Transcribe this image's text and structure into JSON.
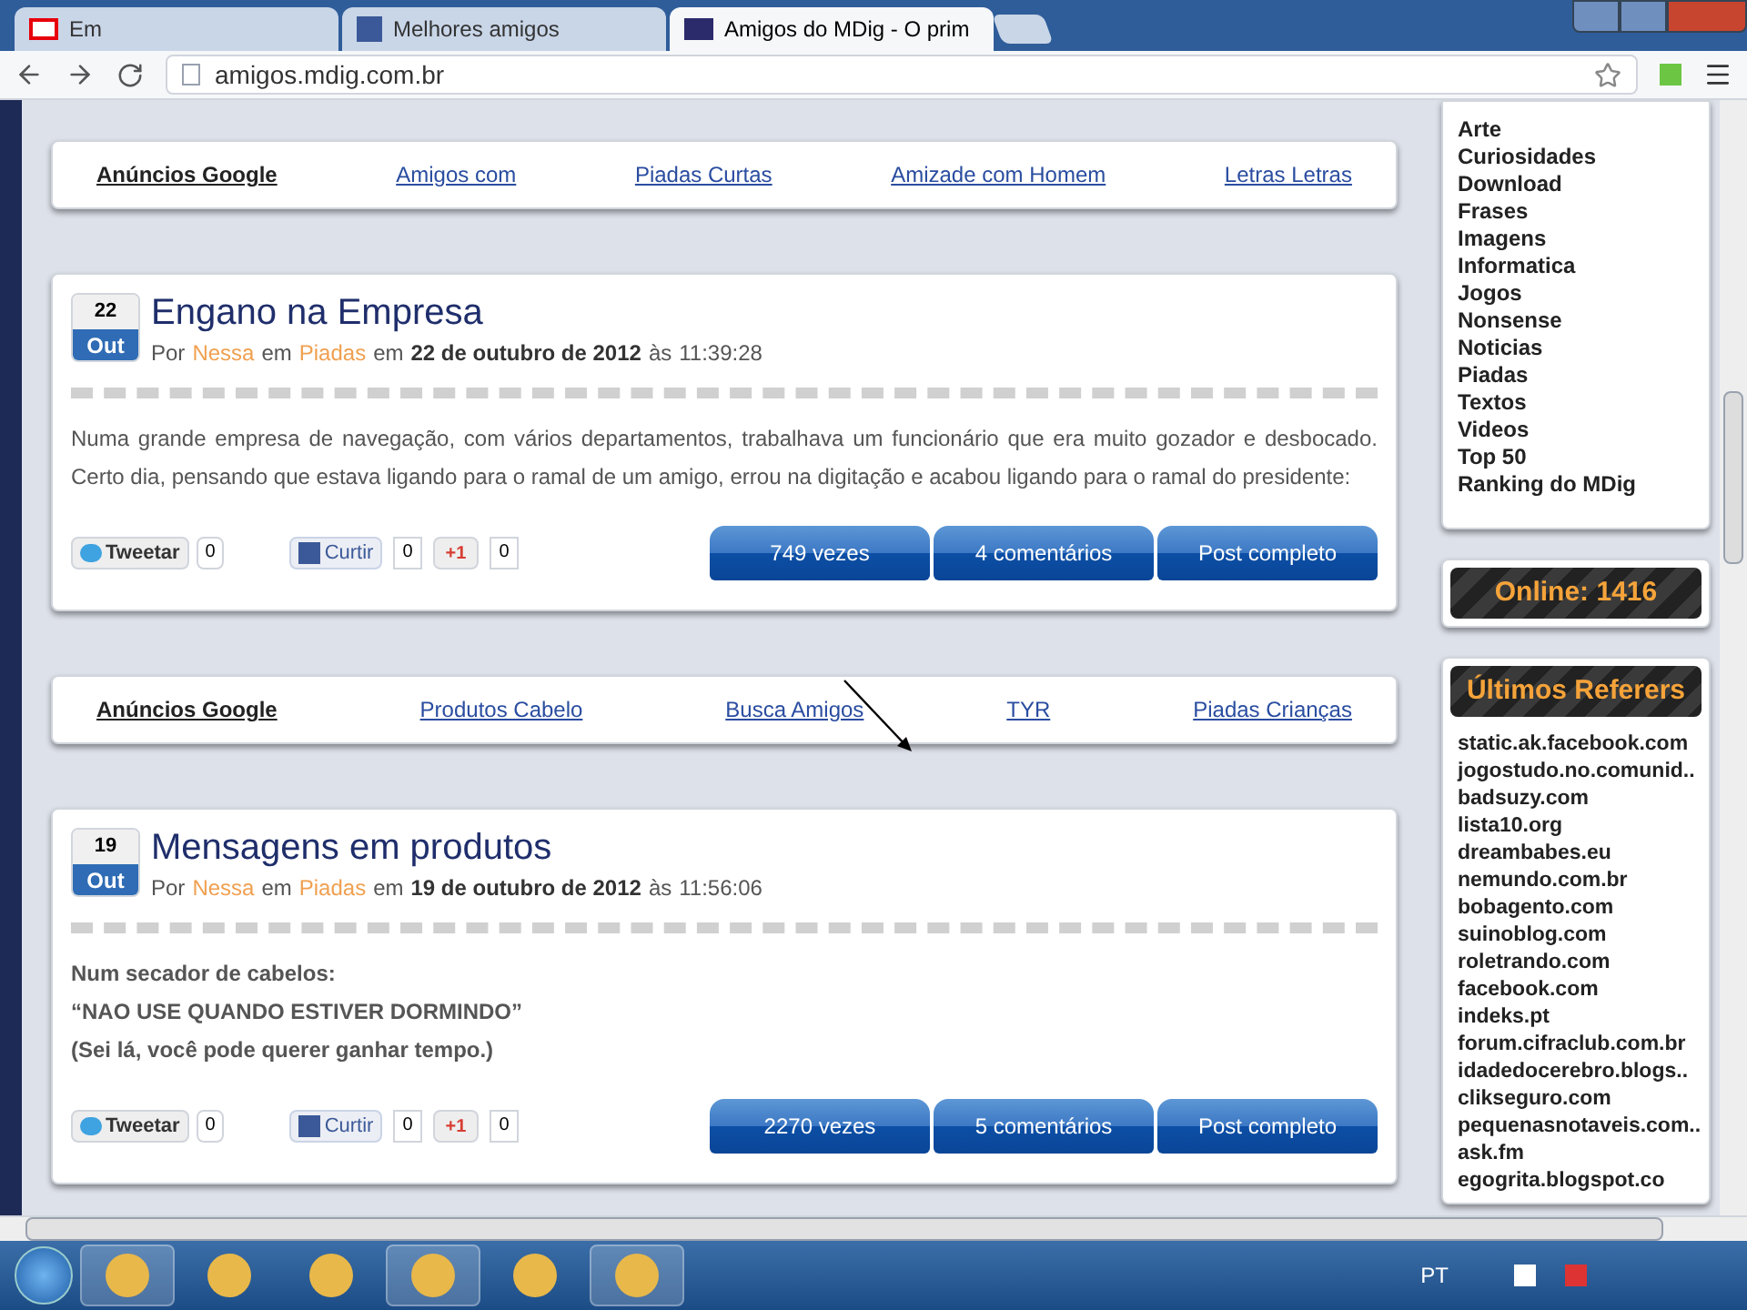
{
  "browser": {
    "tabs": [
      {
        "title": "Em",
        "selected": false
      },
      {
        "title": "Melhores amigos",
        "selected": false
      },
      {
        "title": "Amigos do MDig - O prim",
        "selected": true
      }
    ],
    "address": "amigos.mdig.com.br"
  },
  "ad_bars": [
    {
      "label": "Anúncios Google",
      "links": [
        "Amigos com",
        "Piadas Curtas",
        "Amizade com Homem",
        "Letras Letras"
      ]
    },
    {
      "label": "Anúncios Google",
      "links": [
        "Produtos Cabelo",
        "Busca Amigos",
        "TYR",
        "Piadas Crianças"
      ]
    }
  ],
  "posts": [
    {
      "day": "22",
      "month": "Out",
      "title": "Engano na Empresa",
      "by": "Por",
      "author": "Nessa",
      "in": "em",
      "category": "Piadas",
      "on": "em",
      "date": "22 de outubro de 2012",
      "at": "às",
      "time": "11:39:28",
      "bold_body": false,
      "body": [
        "Numa grande empresa de navegação, com vários departamentos, trabalhava um funcionário que era muito gozador e desbocado. Certo dia, pensando que estava ligando para o ramal de um amigo, errou na digitação e acabou ligando para o ramal do presidente:"
      ],
      "tweet": "Tweetar",
      "tweet_count": "0",
      "like": "Curtir",
      "like_count": "0",
      "plus": "+1",
      "plus_count": "0",
      "buttons": [
        "749 vezes",
        "4 comentários",
        "Post completo"
      ]
    },
    {
      "day": "19",
      "month": "Out",
      "title": "Mensagens em produtos",
      "by": "Por",
      "author": "Nessa",
      "in": "em",
      "category": "Piadas",
      "on": "em",
      "date": "19 de outubro de 2012",
      "at": "às",
      "time": "11:56:06",
      "bold_body": true,
      "body": [
        "Num secador de cabelos:",
        "“NAO USE QUANDO ESTIVER DORMINDO”",
        "(Sei lá, você pode querer ganhar tempo.)"
      ],
      "tweet": "Tweetar",
      "tweet_count": "0",
      "like": "Curtir",
      "like_count": "0",
      "plus": "+1",
      "plus_count": "0",
      "buttons": [
        "2270 vezes",
        "5 comentários",
        "Post completo"
      ]
    }
  ],
  "sidebar": {
    "categories": [
      "Arte",
      "Curiosidades",
      "Download",
      "Frases",
      "Imagens",
      "Informatica",
      "Jogos",
      "Nonsense",
      "Noticias",
      "Piadas",
      "Textos",
      "Videos",
      "Top 50",
      "Ranking do MDig"
    ],
    "online": "Online: 1416",
    "referers_title": "Últimos Referers",
    "referers": [
      "static.ak.facebook.com",
      "jogostudo.no.comunid..",
      "badsuzy.com",
      "lista10.org",
      "dreambabes.eu",
      "nemundo.com.br",
      "bobagento.com",
      "suinoblog.com",
      "roletrando.com",
      "facebook.com",
      "indeks.pt",
      "forum.cifraclub.com.br",
      "idadedocerebro.blogs..",
      "clikseguro.com",
      "pequenasnotaveis.com..",
      "ask.fm",
      "egogrita.blogspot.co"
    ]
  },
  "taskbar": {
    "language": "PT"
  }
}
